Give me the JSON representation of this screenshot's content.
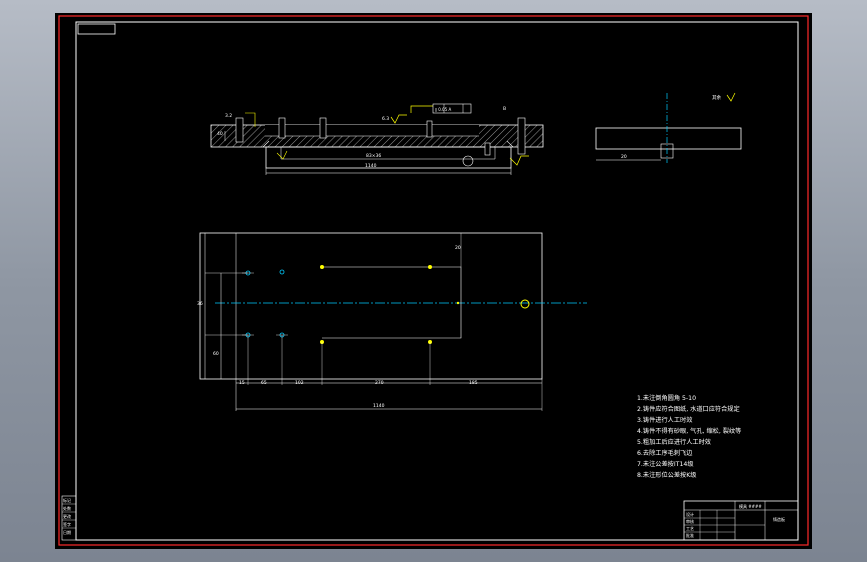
{
  "drawing": {
    "tech_requirements": [
      "1.未注倒角圆角 5-10",
      "2.铸件应符合图纸, 水道口应符合规定",
      "3.铸件进行人工时效",
      "4.铸件不得有砂眼, 气孔, 缩松, 裂纹等",
      "5.粗加工后应进行人工时效",
      "6.去除工序毛刺飞边",
      "7.未注公差按IT14级",
      "8.未注形位公差按K级"
    ],
    "front_view": {
      "dim_inner": "83×36",
      "dim_total": "1140",
      "dim_depth": "40",
      "datum_label": "B",
      "tolerance_text": "∥ 0.05 A",
      "roughness_top": "6.3",
      "roughness_left": "3.2"
    },
    "side_view": {
      "label_bottom": "20",
      "roughness_note": "其余"
    },
    "plan_view": {
      "dim_bottom_total": "1140",
      "dim_segments": [
        "15",
        "65",
        "102",
        "270",
        "185"
      ],
      "dim_left": [
        "36",
        "60"
      ],
      "dim_right": "20"
    },
    "title_block": {
      "cell_1": "模具 ####",
      "cell_2": "铸造板",
      "row_labels": [
        "设计",
        "审核",
        "工艺",
        "批准"
      ]
    },
    "side_block": {
      "labels": [
        "标记",
        "处数",
        "更改",
        "签字",
        "日期"
      ]
    }
  }
}
